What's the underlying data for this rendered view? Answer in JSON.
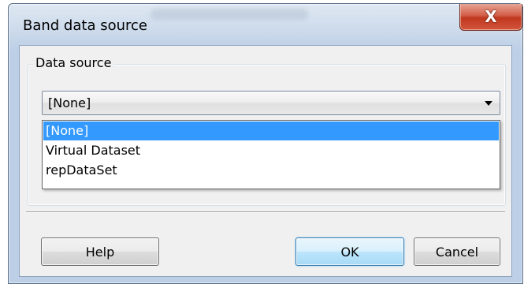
{
  "window": {
    "title": "Band data source",
    "close_glyph": "X"
  },
  "group": {
    "label": "Data source"
  },
  "combo": {
    "selected": "[None]",
    "options": [
      {
        "label": "[None]",
        "selected": true
      },
      {
        "label": "Virtual Dataset",
        "selected": false
      },
      {
        "label": "repDataSet",
        "selected": false
      }
    ]
  },
  "buttons": {
    "help_label": "Help",
    "ok_label": "OK",
    "cancel_label": "Cancel"
  },
  "icons": {
    "close": "close-icon",
    "dropdown_arrow": "chevron-down-icon"
  },
  "colors": {
    "selection": "#3399ff",
    "close_button": "#c0381f",
    "default_button_border": "#3c7fb1"
  }
}
